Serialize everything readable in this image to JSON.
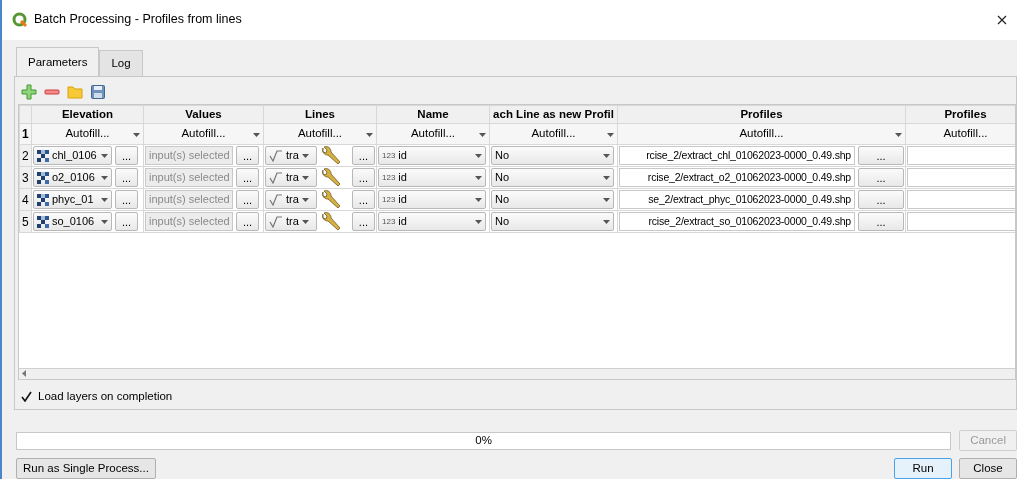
{
  "window": {
    "title": "Batch Processing - Profiles from lines"
  },
  "tabs": [
    {
      "label": "Parameters",
      "selected": true
    },
    {
      "label": "Log",
      "selected": false
    }
  ],
  "table": {
    "columns": [
      "Elevation",
      "Values",
      "Lines",
      "Name",
      "ach Line as new Profil",
      "Profiles",
      "Profiles"
    ],
    "autofill_row": {
      "number": "1",
      "cells": [
        "Autofill...",
        "Autofill...",
        "Autofill...",
        "Autofill...",
        "Autofill...",
        "Autofill...",
        "Autofill..."
      ]
    },
    "rows": [
      {
        "number": "2",
        "elevation": "chl_0106",
        "elevation_button": "...",
        "values": {
          "text": "input(s) selected",
          "disabled": true
        },
        "values_button": "...",
        "lines": "tra",
        "lines_button": "...",
        "name": {
          "type_label": "123",
          "field": "id"
        },
        "each_line": "No",
        "profiles": "rcise_2/extract_chl_01062023-0000_0.49.shp",
        "profiles_button": "..."
      },
      {
        "number": "3",
        "elevation": "o2_0106",
        "elevation_button": "...",
        "values": {
          "text": "input(s) selected",
          "disabled": true
        },
        "values_button": "...",
        "lines": "tra",
        "lines_button": "...",
        "name": {
          "type_label": "123",
          "field": "id"
        },
        "each_line": "No",
        "profiles": "rcise_2/extract_o2_01062023-0000_0.49.shp",
        "profiles_button": "..."
      },
      {
        "number": "4",
        "elevation": "phyc_01",
        "elevation_button": "...",
        "values": {
          "text": "input(s) selected",
          "disabled": true
        },
        "values_button": "...",
        "lines": "tra",
        "lines_button": "...",
        "name": {
          "type_label": "123",
          "field": "id"
        },
        "each_line": "No",
        "profiles": "se_2/extract_phyc_01062023-0000_0.49.shp",
        "profiles_button": "..."
      },
      {
        "number": "5",
        "elevation": "so_0106",
        "elevation_button": "...",
        "values": {
          "text": "input(s) selected",
          "disabled": true
        },
        "values_button": "...",
        "lines": "tra",
        "lines_button": "...",
        "name": {
          "type_label": "123",
          "field": "id"
        },
        "each_line": "No",
        "profiles": "rcise_2/extract_so_01062023-0000_0.49.shp",
        "profiles_button": "..."
      }
    ]
  },
  "load_layers": {
    "label": "Load layers on completion",
    "checked": true
  },
  "progress": {
    "level": 0,
    "text": "0%"
  },
  "buttons": [
    {
      "label": "Cancel",
      "kind": "cancel",
      "disabled": true,
      "default": false
    },
    {
      "label": "Run as Single Process...",
      "kind": "single",
      "disabled": false,
      "default": false
    },
    {
      "label": "Run",
      "kind": "run",
      "disabled": false,
      "default": true
    },
    {
      "label": "Close",
      "kind": "close",
      "disabled": false,
      "default": false
    }
  ]
}
